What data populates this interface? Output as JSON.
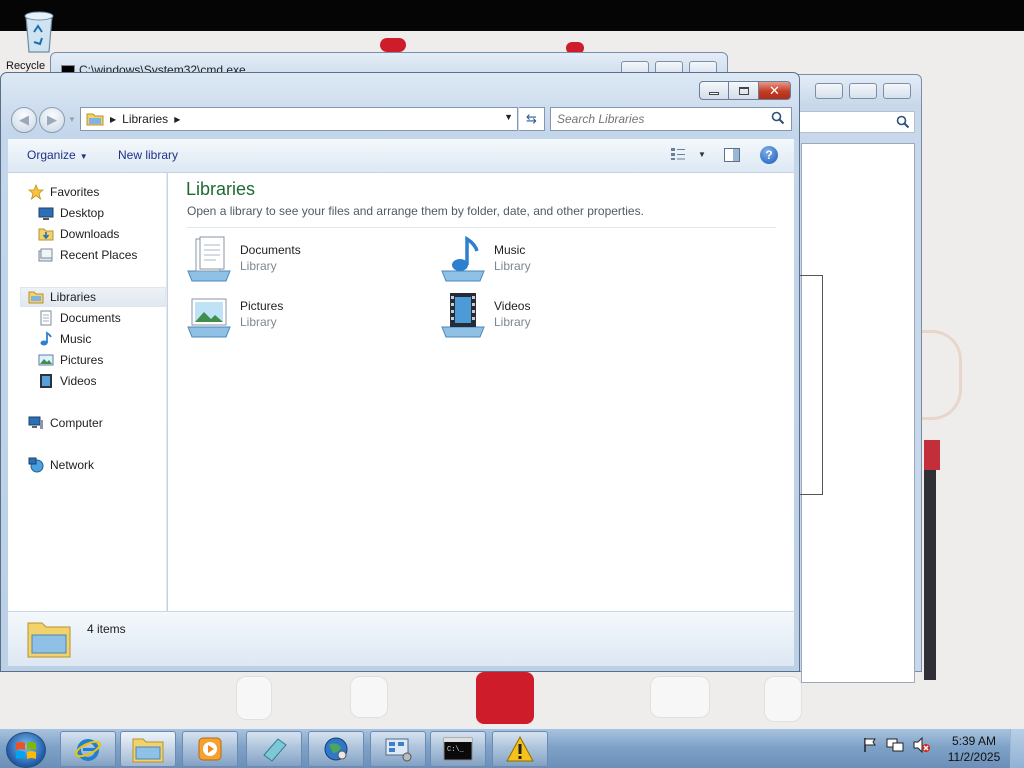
{
  "desktop": {
    "recycle_bin_label": "Recycle"
  },
  "background_windows": {
    "cmd_title": "C:\\windows\\System32\\cmd.exe"
  },
  "explorer": {
    "address": {
      "crumb": "Libraries"
    },
    "search": {
      "placeholder": "Search Libraries"
    },
    "toolbar": {
      "organize": "Organize",
      "new_library": "New library"
    },
    "nav": {
      "favorites": {
        "label": "Favorites",
        "items": [
          "Desktop",
          "Downloads",
          "Recent Places"
        ]
      },
      "libraries": {
        "label": "Libraries",
        "items": [
          "Documents",
          "Music",
          "Pictures",
          "Videos"
        ]
      },
      "computer": "Computer",
      "network": "Network"
    },
    "content": {
      "title": "Libraries",
      "subtitle": "Open a library to see your files and arrange them by folder, date, and other properties.",
      "libraries": [
        {
          "name": "Documents",
          "type": "Library",
          "icon": "documents-library-icon"
        },
        {
          "name": "Music",
          "type": "Library",
          "icon": "music-library-icon"
        },
        {
          "name": "Pictures",
          "type": "Library",
          "icon": "pictures-library-icon"
        },
        {
          "name": "Videos",
          "type": "Library",
          "icon": "videos-library-icon"
        }
      ]
    },
    "details": {
      "count": "4 items"
    }
  },
  "taskbar": {
    "clock": {
      "time": "5:39 AM",
      "date": "11/2/2025"
    },
    "pinned": [
      "internet-explorer-icon",
      "windows-explorer-icon",
      "media-player-icon",
      "notepad-icon",
      "network-globe-icon",
      "control-panel-icon",
      "command-prompt-icon",
      "warning-icon"
    ]
  },
  "colors": {
    "heading_green": "#1e6a33",
    "command_blue": "#1e3287",
    "close_red": "#c23d25"
  }
}
